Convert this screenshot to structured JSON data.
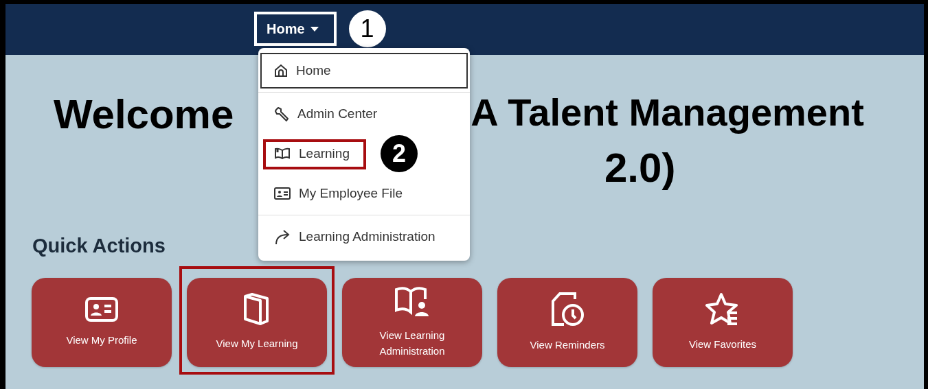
{
  "nav": {
    "menu_button": "Home",
    "callout": "1"
  },
  "menu": {
    "groups": [
      [
        {
          "label": "Home",
          "focused": true,
          "highlighted": false
        }
      ],
      [
        {
          "label": "Admin Center",
          "focused": false,
          "highlighted": false
        },
        {
          "label": "Learning",
          "focused": false,
          "highlighted": true,
          "callout": "2"
        },
        {
          "label": "My Employee File",
          "focused": false,
          "highlighted": false
        }
      ],
      [
        {
          "label": "Learning Administration",
          "focused": false,
          "highlighted": false
        }
      ]
    ]
  },
  "heading": {
    "line_1_left": "Welcome",
    "line_1_right": "A Talent Management",
    "line_2": "2.0)"
  },
  "quick_actions": {
    "title": "Quick Actions",
    "tiles": [
      {
        "label": "View My Profile",
        "highlighted": false
      },
      {
        "label": "View My Learning",
        "highlighted": true
      },
      {
        "label": "View Learning Administration",
        "highlighted": false
      },
      {
        "label": "View Reminders",
        "highlighted": false
      },
      {
        "label": "View Favorites",
        "highlighted": false
      }
    ]
  }
}
